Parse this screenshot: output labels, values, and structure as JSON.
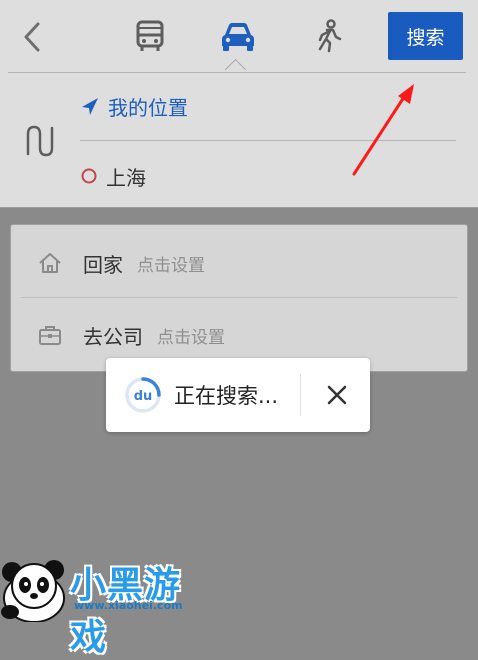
{
  "header": {
    "modes": [
      {
        "name": "bus",
        "active": false
      },
      {
        "name": "car",
        "active": true
      },
      {
        "name": "walk",
        "active": false
      }
    ],
    "search_label": "搜索"
  },
  "route": {
    "origin": "我的位置",
    "destination": "上海"
  },
  "shortcuts": [
    {
      "label": "回家",
      "hint": "点击设置",
      "icon": "home-icon"
    },
    {
      "label": "去公司",
      "hint": "点击设置",
      "icon": "briefcase-icon"
    }
  ],
  "toast": {
    "message": "正在搜索..."
  },
  "watermark": {
    "text": "小黑游戏",
    "url": "www.xiaohei.com"
  },
  "colors": {
    "accent": "#1a5bc0",
    "overlay_bg": "#8a8a8a",
    "annotation_red": "#ff1a1a"
  }
}
